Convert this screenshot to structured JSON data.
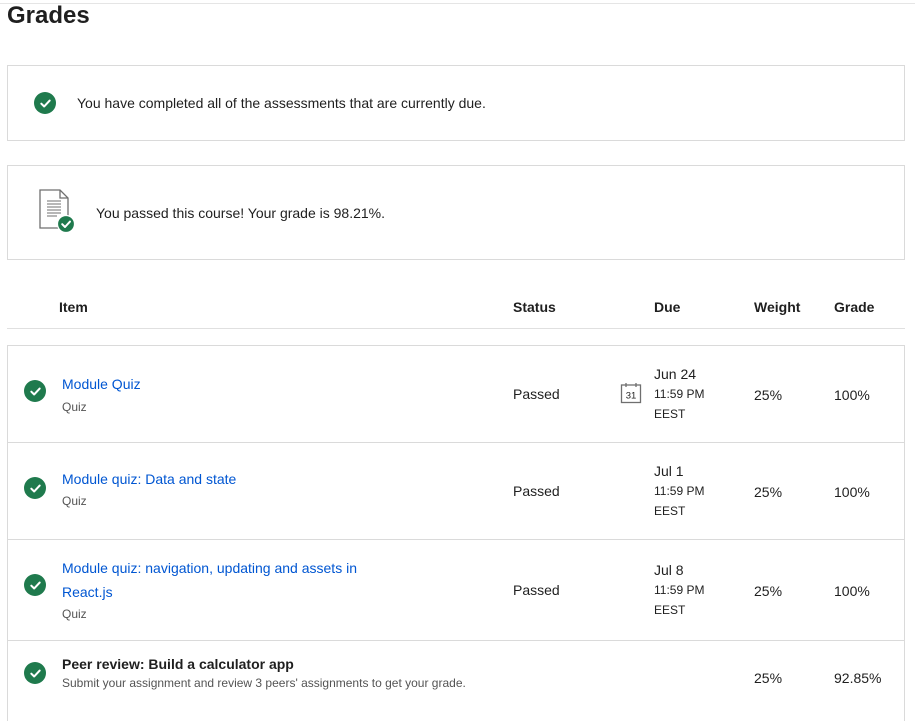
{
  "page": {
    "title": "Grades"
  },
  "notices": {
    "completed": "You have completed all of the assessments that are currently due.",
    "passed": "You passed this course! Your grade is 98.21%."
  },
  "table": {
    "headers": {
      "item": "Item",
      "status": "Status",
      "due": "Due",
      "weight": "Weight",
      "grade": "Grade"
    },
    "rows": [
      {
        "title": "Module Quiz",
        "type": "Quiz",
        "status": "Passed",
        "due_date": "Jun 24",
        "due_time": "11:59 PM",
        "due_tz": "EEST",
        "weight": "25%",
        "grade": "100%"
      },
      {
        "title": "Module quiz: Data and state",
        "type": "Quiz",
        "status": "Passed",
        "due_date": "Jul 1",
        "due_time": "11:59 PM",
        "due_tz": "EEST",
        "weight": "25%",
        "grade": "100%"
      },
      {
        "title": "Module quiz: navigation, updating and assets in React.js",
        "type": "Quiz",
        "status": "Passed",
        "due_date": "Jul 8",
        "due_time": "11:59 PM",
        "due_tz": "EEST",
        "weight": "25%",
        "grade": "100%"
      },
      {
        "title": "Peer review: Build a calculator app",
        "type": "Submit your assignment and review 3 peers' assignments to get your grade.",
        "status": "",
        "weight": "25%",
        "grade": "92.85%"
      }
    ]
  },
  "calendar_icon_day": "31",
  "icons": {
    "check": "check-circle-icon",
    "document": "document-check-icon",
    "calendar": "calendar-icon"
  },
  "colors": {
    "accent_green": "#1f7a4d",
    "link_blue": "#0056d2"
  }
}
